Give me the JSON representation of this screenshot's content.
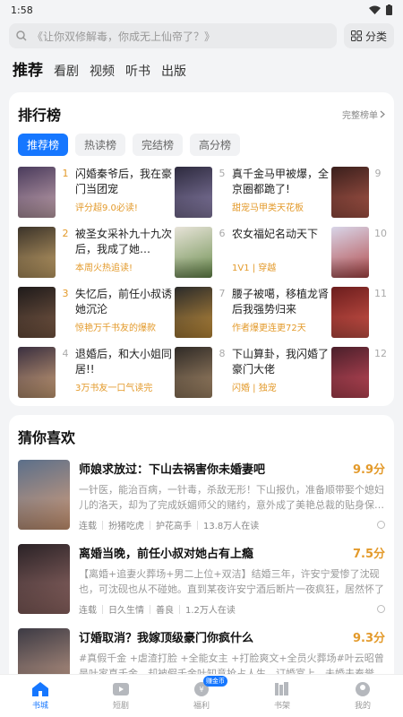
{
  "status": {
    "time": "1:58"
  },
  "search": {
    "placeholder": "《让你双修解毒，你成无上仙帝了？》",
    "category_label": "分类"
  },
  "top_tabs": [
    "推荐",
    "看剧",
    "视频",
    "听书",
    "出版"
  ],
  "ranking": {
    "title": "排行榜",
    "more_label": "完整榜单",
    "chips": [
      "推荐榜",
      "热读榜",
      "完结榜",
      "高分榜"
    ],
    "items": [
      {
        "num": "1",
        "title": "闪婚秦爷后，我在豪门当团宠",
        "tag": "评分超9.0必读!",
        "cover": [
          "#4a3b5c",
          "#c7a7b0"
        ]
      },
      {
        "num": "5",
        "title": "真千金马甲被爆，全京圈都跪了!",
        "tag": "甜宠马甲类天花板",
        "cover": [
          "#2d2a3e",
          "#8a7fa8"
        ]
      },
      {
        "num": "9",
        "title": "",
        "tag": "",
        "cover": [
          "#3a1f1c",
          "#b0594a"
        ]
      },
      {
        "num": "2",
        "title": "被圣女采补九十九次后，我成了她…",
        "tag": "本周火热追读!",
        "cover": [
          "#3b3329",
          "#c9a66b"
        ]
      },
      {
        "num": "6",
        "title": "农女福妃名动天下",
        "tag": "1V1 | 穿越",
        "cover": [
          "#e7e3d8",
          "#6b8e4e"
        ]
      },
      {
        "num": "10",
        "title": "",
        "tag": "",
        "cover": [
          "#d8d5e8",
          "#b34a4a"
        ]
      },
      {
        "num": "3",
        "title": "失忆后，前任小叔诱她沉沦",
        "tag": "惊艳万千书友的爆款",
        "cover": [
          "#1e1a1a",
          "#7d5b45"
        ]
      },
      {
        "num": "7",
        "title": "腰子被噶，移植龙肾后我强势归来",
        "tag": "作者爆更连更72天",
        "cover": [
          "#2a2a2a",
          "#c4903b"
        ]
      },
      {
        "num": "11",
        "title": "",
        "tag": "",
        "cover": [
          "#6b1d1d",
          "#d2564a"
        ]
      },
      {
        "num": "4",
        "title": "退婚后，和大小姐同居!!",
        "tag": "3万书友一口气读完",
        "cover": [
          "#3a2f3f",
          "#d0a47a"
        ]
      },
      {
        "num": "8",
        "title": "下山算卦，我闪婚了豪门大佬",
        "tag": "闪婚 | 独宠",
        "cover": [
          "#2f2a26",
          "#a88b6a"
        ]
      },
      {
        "num": "12",
        "title": "",
        "tag": "",
        "cover": [
          "#4a1f2a",
          "#c84a5a"
        ]
      }
    ]
  },
  "guess": {
    "title": "猜你喜欢",
    "books": [
      {
        "title": "师娘求放过：下山去祸害你未婚妻吧",
        "score": "9.9分",
        "desc": "一针医，能治百病，一针毒，杀敌无形！下山报仇，准备顺带娶个媳妇儿的洛天，却为了完成妖媚师父的赌约，意外成了美艳总裁的贴身保…",
        "meta": [
          "连载",
          "扮猪吃虎",
          "护花高手",
          "13.8万人在读"
        ],
        "cover": [
          "#5b6f8a",
          "#d9a07a"
        ]
      },
      {
        "title": "离婚当晚，前任小叔对她占有上瘾",
        "score": "7.5分",
        "desc": "【离婚+追妻火葬场+男二上位+双洁】结婚三年，许安宁爱惨了沈砚也，可沈砚也从不碰她。直到某夜许安宁酒后断片一夜疯狂，居然怀了孕…",
        "meta": [
          "连载",
          "日久生情",
          "善良",
          "1.2万人在读"
        ],
        "cover": [
          "#2a2226",
          "#9a6e6a"
        ]
      },
      {
        "title": "订婚取消？我嫁顶级豪门你疯什么",
        "score": "9.3分",
        "desc": "#真假千金 +虐渣打脸 +全能女主 +打脸爽文+全员火葬场#叶云昭曾是叶家真千金，却被假千金叶知意抢占人生，订婚宴上，未婚夫秦誉也…",
        "meta": [],
        "cover": [
          "#3c3a44",
          "#c8a08a"
        ]
      }
    ]
  },
  "nav": [
    {
      "label": "书城",
      "icon": "home-icon",
      "active": true
    },
    {
      "label": "短剧",
      "icon": "play-icon",
      "active": false
    },
    {
      "label": "福利",
      "icon": "gift-icon",
      "active": false,
      "badge": "赚金币"
    },
    {
      "label": "书架",
      "icon": "bookshelf-icon",
      "active": false
    },
    {
      "label": "我的",
      "icon": "profile-icon",
      "active": false
    }
  ]
}
